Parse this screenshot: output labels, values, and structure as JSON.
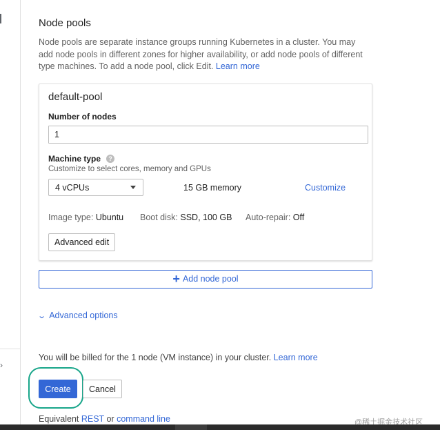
{
  "section": {
    "title": "Node pools",
    "description": "Node pools are separate instance groups running Kubernetes in a cluster. You may add node pools in different zones for higher availability, or add node pools of different type machines. To add a node pool, click Edit.",
    "learn_more": "Learn more"
  },
  "pool": {
    "name": "default-pool",
    "nodes_label": "Number of nodes",
    "nodes_value": "1",
    "machine_type_label": "Machine type",
    "help_icon": "?",
    "machine_type_hint": "Customize to select cores, memory and GPUs",
    "cpu_selected": "4 vCPUs",
    "memory": "15 GB memory",
    "customize": "Customize",
    "image_type_label": "Image type:",
    "image_type_value": "Ubuntu",
    "boot_disk_label": "Boot disk:",
    "boot_disk_value": "SSD, 100 GB",
    "auto_repair_label": "Auto-repair:",
    "auto_repair_value": "Off",
    "advanced_edit": "Advanced edit"
  },
  "add_node_pool": "Add node pool",
  "advanced_options": "Advanced options",
  "billing": {
    "text": "You will be billed for the 1 node (VM instance) in your cluster.",
    "learn_more": "Learn more"
  },
  "actions": {
    "create": "Create",
    "cancel": "Cancel"
  },
  "equivalent": {
    "prefix": "Equivalent",
    "rest": "REST",
    "or": "or",
    "command_line": "command line"
  },
  "watermark": "@稀土掘金技术社区",
  "colors": {
    "accent": "#3367d6",
    "highlight_ring": "#17a589"
  }
}
